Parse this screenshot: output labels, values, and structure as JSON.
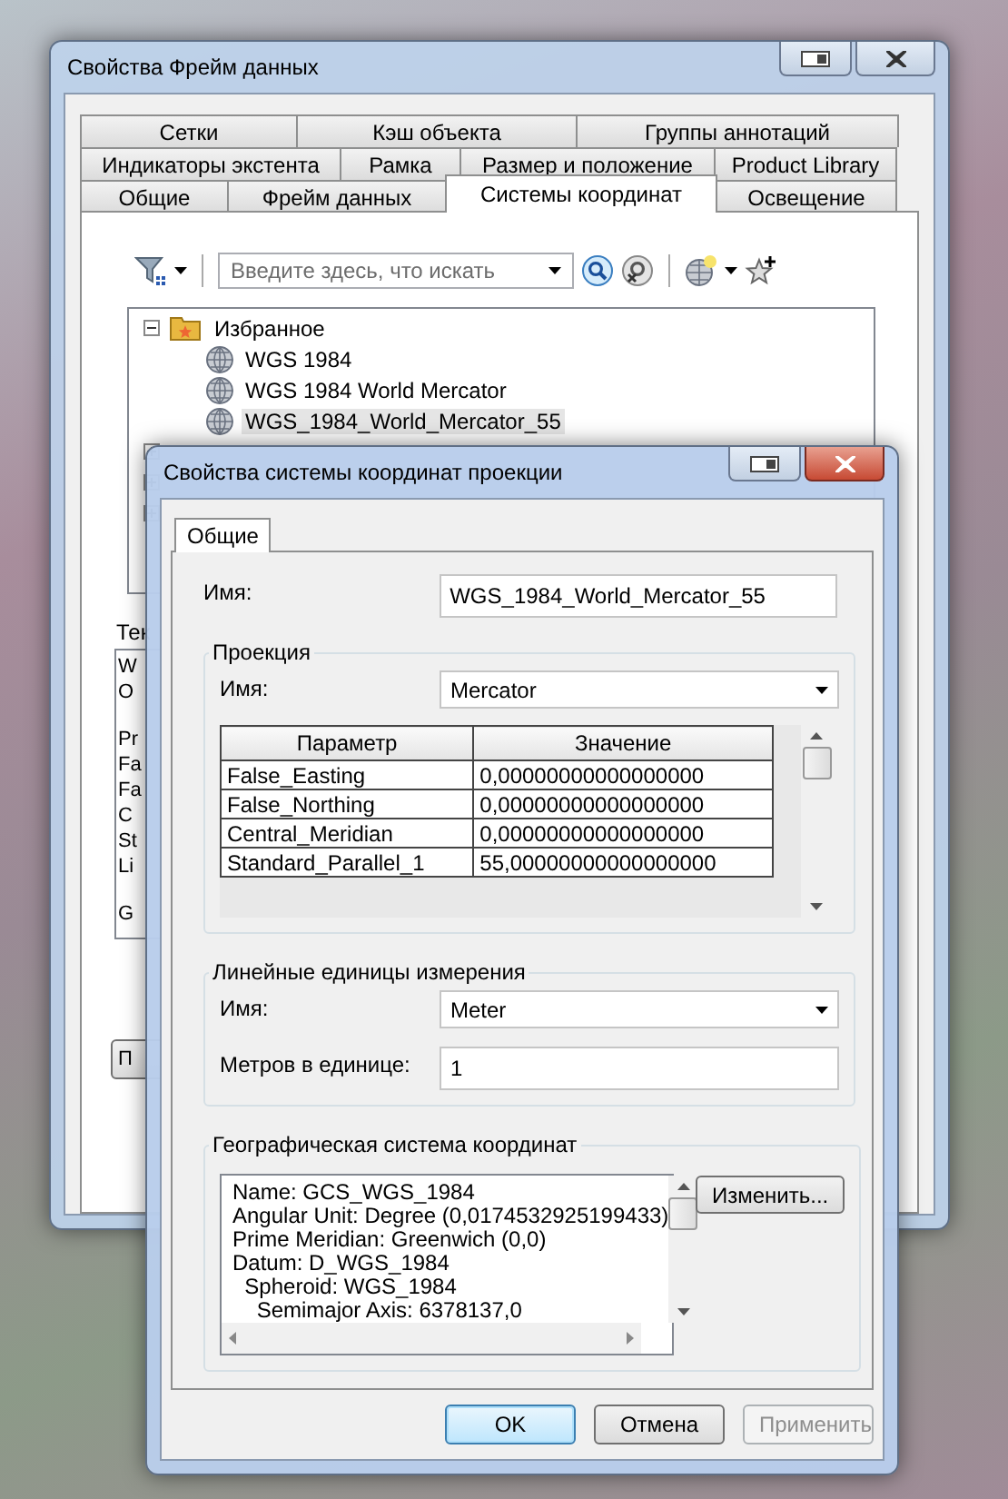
{
  "back_window": {
    "title": "Свойства Фрейм данных",
    "tab_rows": [
      [
        {
          "label": "Сетки",
          "selected": false
        },
        {
          "label": "Кэш объекта",
          "selected": false
        },
        {
          "label": "Группы аннотаций",
          "selected": false
        }
      ],
      [
        {
          "label": "Индикаторы экстента",
          "selected": false
        },
        {
          "label": "Рамка",
          "selected": false
        },
        {
          "label": "Размер и положение",
          "selected": false
        },
        {
          "label": "Product Library",
          "selected": false
        }
      ],
      [
        {
          "label": "Общие",
          "selected": false
        },
        {
          "label": "Фрейм данных",
          "selected": false
        },
        {
          "label": "Системы координат",
          "selected": true
        },
        {
          "label": "Освещение",
          "selected": false
        }
      ]
    ],
    "search": {
      "placeholder": "Введите здесь, что искать"
    },
    "tree": [
      {
        "label": "Избранное",
        "expanded": true,
        "children": [
          {
            "label": "WGS 1984",
            "selected": false
          },
          {
            "label": "WGS 1984 World Mercator",
            "selected": false
          },
          {
            "label": "WGS_1984_World_Mercator_55",
            "selected": true
          }
        ]
      },
      {
        "expanded": false
      },
      {
        "expanded": false
      },
      {
        "expanded": false
      }
    ],
    "details_label": "Тек",
    "details_groups": [
      [
        "W",
        "O"
      ],
      [
        "Pr",
        "Fa",
        "Fa",
        "C",
        "St",
        "Li"
      ],
      [
        "G"
      ]
    ],
    "partial_button": "П"
  },
  "front_window": {
    "title": "Свойства системы координат проекции",
    "tabs": [
      {
        "label": "Общие",
        "selected": true
      }
    ],
    "name": {
      "label": "Имя:",
      "value": "WGS_1984_World_Mercator_55"
    },
    "projection": {
      "title": "Проекция",
      "name_label": "Имя:",
      "name_value": "Mercator",
      "columns": [
        "Параметр",
        "Значение"
      ],
      "rows": [
        [
          "False_Easting",
          "0,00000000000000000"
        ],
        [
          "False_Northing",
          "0,00000000000000000"
        ],
        [
          "Central_Meridian",
          "0,00000000000000000"
        ],
        [
          "Standard_Parallel_1",
          "55,00000000000000000"
        ]
      ]
    },
    "linear_units": {
      "title": "Линейные единицы измерения",
      "name_label": "Имя:",
      "name_value": "Meter",
      "meters_label": "Метров в единице:",
      "meters_value": "1"
    },
    "geographic": {
      "title": "Географическая система координат",
      "lines": [
        "Name: GCS_WGS_1984",
        "Angular Unit: Degree (0,0174532925199433)",
        "Prime Meridian: Greenwich (0,0)",
        "Datum: D_WGS_1984",
        "  Spheroid: WGS_1984",
        "    Semimajor Axis: 6378137,0"
      ],
      "button": "Изменить..."
    },
    "buttons": [
      {
        "label": "OK",
        "default": true,
        "disabled": false
      },
      {
        "label": "Отмена",
        "default": false,
        "disabled": false
      },
      {
        "label": "Применить",
        "default": false,
        "disabled": true
      }
    ]
  }
}
